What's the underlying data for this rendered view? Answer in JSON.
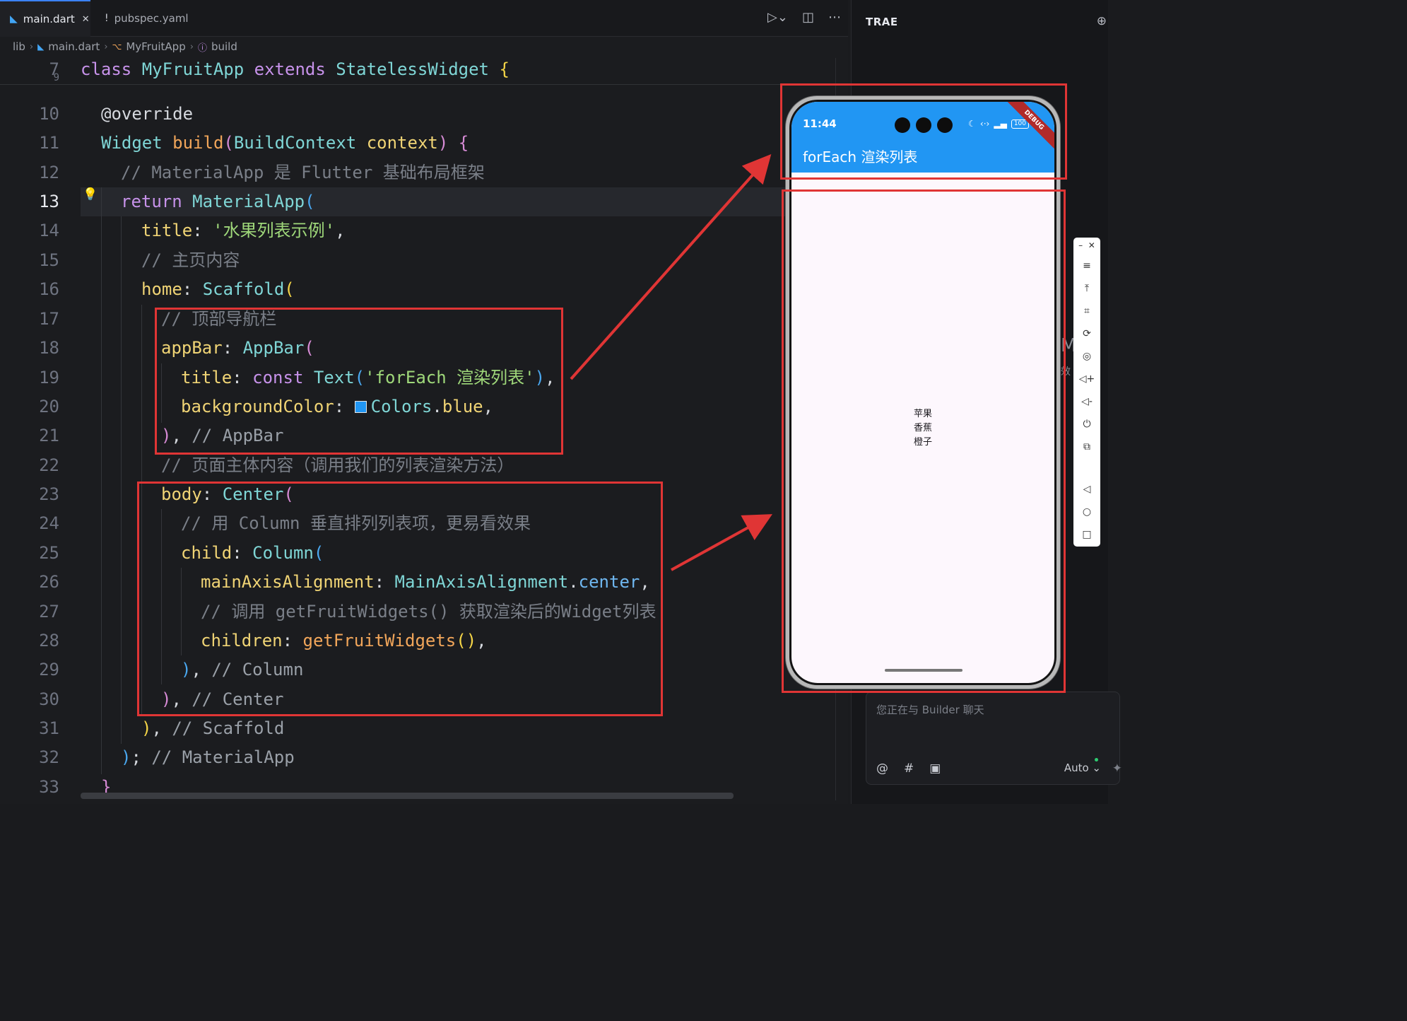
{
  "tabs": [
    {
      "label": "main.dart",
      "icon": "dart-icon",
      "active": true
    },
    {
      "label": "pubspec.yaml",
      "icon": "exclamation-icon",
      "active": false
    }
  ],
  "breadcrumb": [
    "lib",
    "main.dart",
    "MyFruitApp",
    "build"
  ],
  "editor": {
    "current_line": 13,
    "sticky": {
      "ln": "7",
      "partial_ln": "9"
    },
    "line_numbers": [
      "10",
      "11",
      "12",
      "13",
      "14",
      "15",
      "16",
      "17",
      "18",
      "19",
      "20",
      "21",
      "22",
      "23",
      "24",
      "25",
      "26",
      "27",
      "28",
      "29",
      "30",
      "31",
      "32",
      "33"
    ]
  },
  "panel": {
    "title": "TRAE",
    "chat_placeholder": "您正在与 Builder 聊天",
    "mode": "Auto",
    "peek_text": "M",
    "peek_text2": "效"
  },
  "phone": {
    "time": "11:44",
    "battery": "100",
    "appbar_title": "forEach 渲染列表",
    "debug_banner": "DEBUG",
    "items": [
      "苹果",
      "香蕉",
      "橙子"
    ]
  },
  "colors": {
    "accent": "#3b82f6",
    "appbar": "#2196f3",
    "highlight_box": "#e03535"
  }
}
